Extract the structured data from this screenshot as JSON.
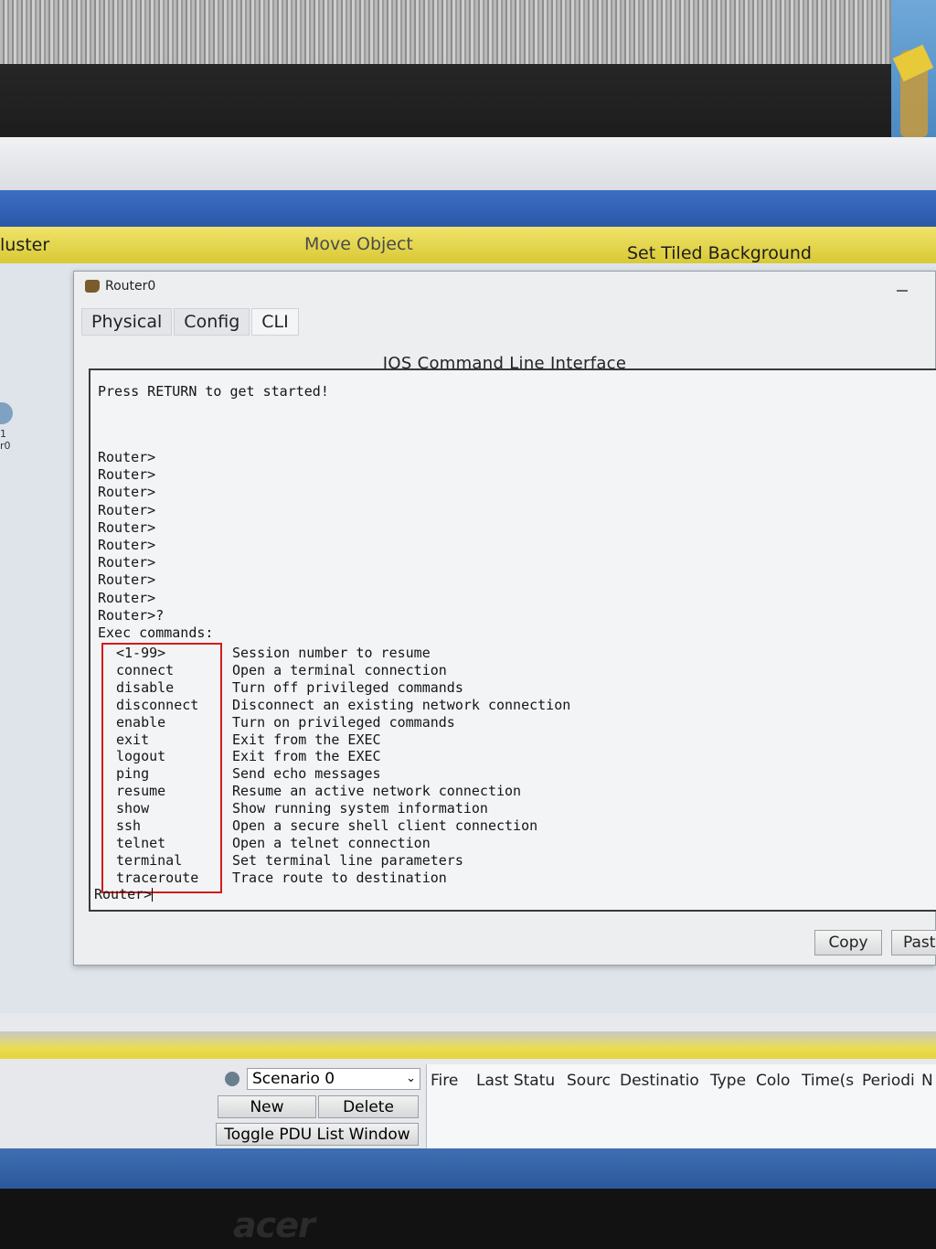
{
  "menubar": {
    "left_label": "luster",
    "move_object": "Move Object",
    "set_tiled_background": "Set Tiled Background"
  },
  "left_device": {
    "label_1": "1",
    "label_2": "r0"
  },
  "window": {
    "title": "Router0",
    "tabs": [
      "Physical",
      "Config",
      "CLI"
    ],
    "active_tab": "CLI",
    "heading": "IOS Command Line Interface"
  },
  "terminal": {
    "intro": "Press RETURN to get started!",
    "prompts": [
      "Router>",
      "Router>",
      "Router>",
      "Router>",
      "Router>",
      "Router>",
      "Router>",
      "Router>",
      "Router>",
      "Router>?"
    ],
    "exec_header": "Exec commands:",
    "commands": [
      {
        "cmd": "<1-99>",
        "desc": "Session number to resume"
      },
      {
        "cmd": "connect",
        "desc": "Open a terminal connection"
      },
      {
        "cmd": "disable",
        "desc": "Turn off privileged commands"
      },
      {
        "cmd": "disconnect",
        "desc": "Disconnect an existing network connection"
      },
      {
        "cmd": "enable",
        "desc": "Turn on privileged commands"
      },
      {
        "cmd": "exit",
        "desc": "Exit from the EXEC"
      },
      {
        "cmd": "logout",
        "desc": "Exit from the EXEC"
      },
      {
        "cmd": "ping",
        "desc": "Send echo messages"
      },
      {
        "cmd": "resume",
        "desc": "Resume an active network connection"
      },
      {
        "cmd": "show",
        "desc": "Show running system information"
      },
      {
        "cmd": "ssh",
        "desc": "Open a secure shell client connection"
      },
      {
        "cmd": "telnet",
        "desc": "Open a telnet connection"
      },
      {
        "cmd": "terminal",
        "desc": "Set terminal line parameters"
      },
      {
        "cmd": "traceroute",
        "desc": "Trace route to destination"
      }
    ],
    "final_prompt": "Router>"
  },
  "buttons": {
    "copy": "Copy",
    "paste": "Past"
  },
  "pdu_panel": {
    "scenario": "Scenario 0",
    "new": "New",
    "delete": "Delete",
    "toggle": "Toggle PDU List Window",
    "columns": [
      "Fire",
      "Last Statu",
      "Sourc",
      "Destinatio",
      "Type",
      "Colo",
      "Time(s",
      "Periodi",
      "N"
    ]
  },
  "brand": "acer",
  "colors": {
    "highlight": "#d31c1c",
    "yellow_bar": "#e3d43c",
    "blue_bar": "#2b58a8"
  }
}
